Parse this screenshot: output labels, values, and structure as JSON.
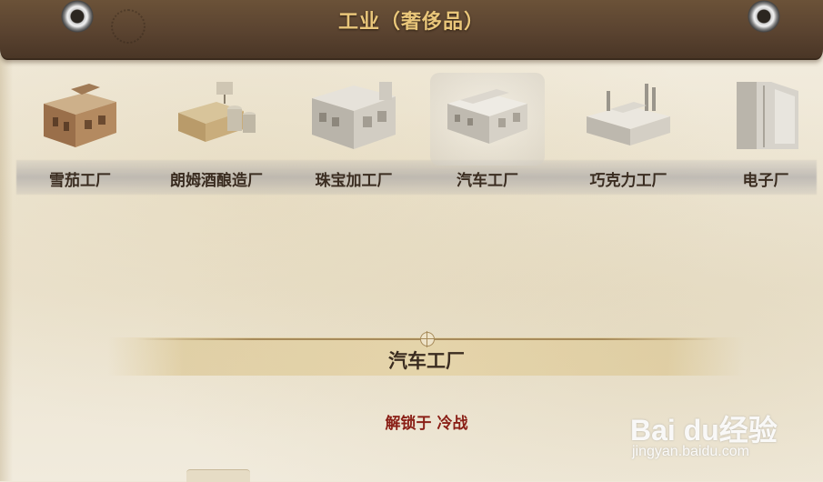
{
  "header": {
    "title": "工业（奢侈品）"
  },
  "buildings": [
    {
      "id": "cigar",
      "label": "雪茄工厂",
      "icon": "cigar-factory-icon",
      "selected": false
    },
    {
      "id": "rum",
      "label": "朗姆酒酿造厂",
      "icon": "rum-distillery-icon",
      "selected": false
    },
    {
      "id": "jewelry",
      "label": "珠宝加工厂",
      "icon": "jewelry-factory-icon",
      "selected": false
    },
    {
      "id": "car",
      "label": "汽车工厂",
      "icon": "car-factory-icon",
      "selected": true
    },
    {
      "id": "chocolate",
      "label": "巧克力工厂",
      "icon": "chocolate-factory-icon",
      "selected": false
    },
    {
      "id": "electronics",
      "label": "电子厂",
      "icon": "electronics-factory-icon",
      "selected": false
    }
  ],
  "detail": {
    "title": "汽车工厂",
    "unlock": "解锁于 冷战"
  },
  "watermark": {
    "logo": "Bai du经验",
    "url": "jingyan.baidu.com"
  },
  "colors": {
    "header_bg": "#5a4330",
    "title_gold": "#e9c67a",
    "unlock_red": "#8a1f16",
    "label_dark": "#3a2c20"
  }
}
